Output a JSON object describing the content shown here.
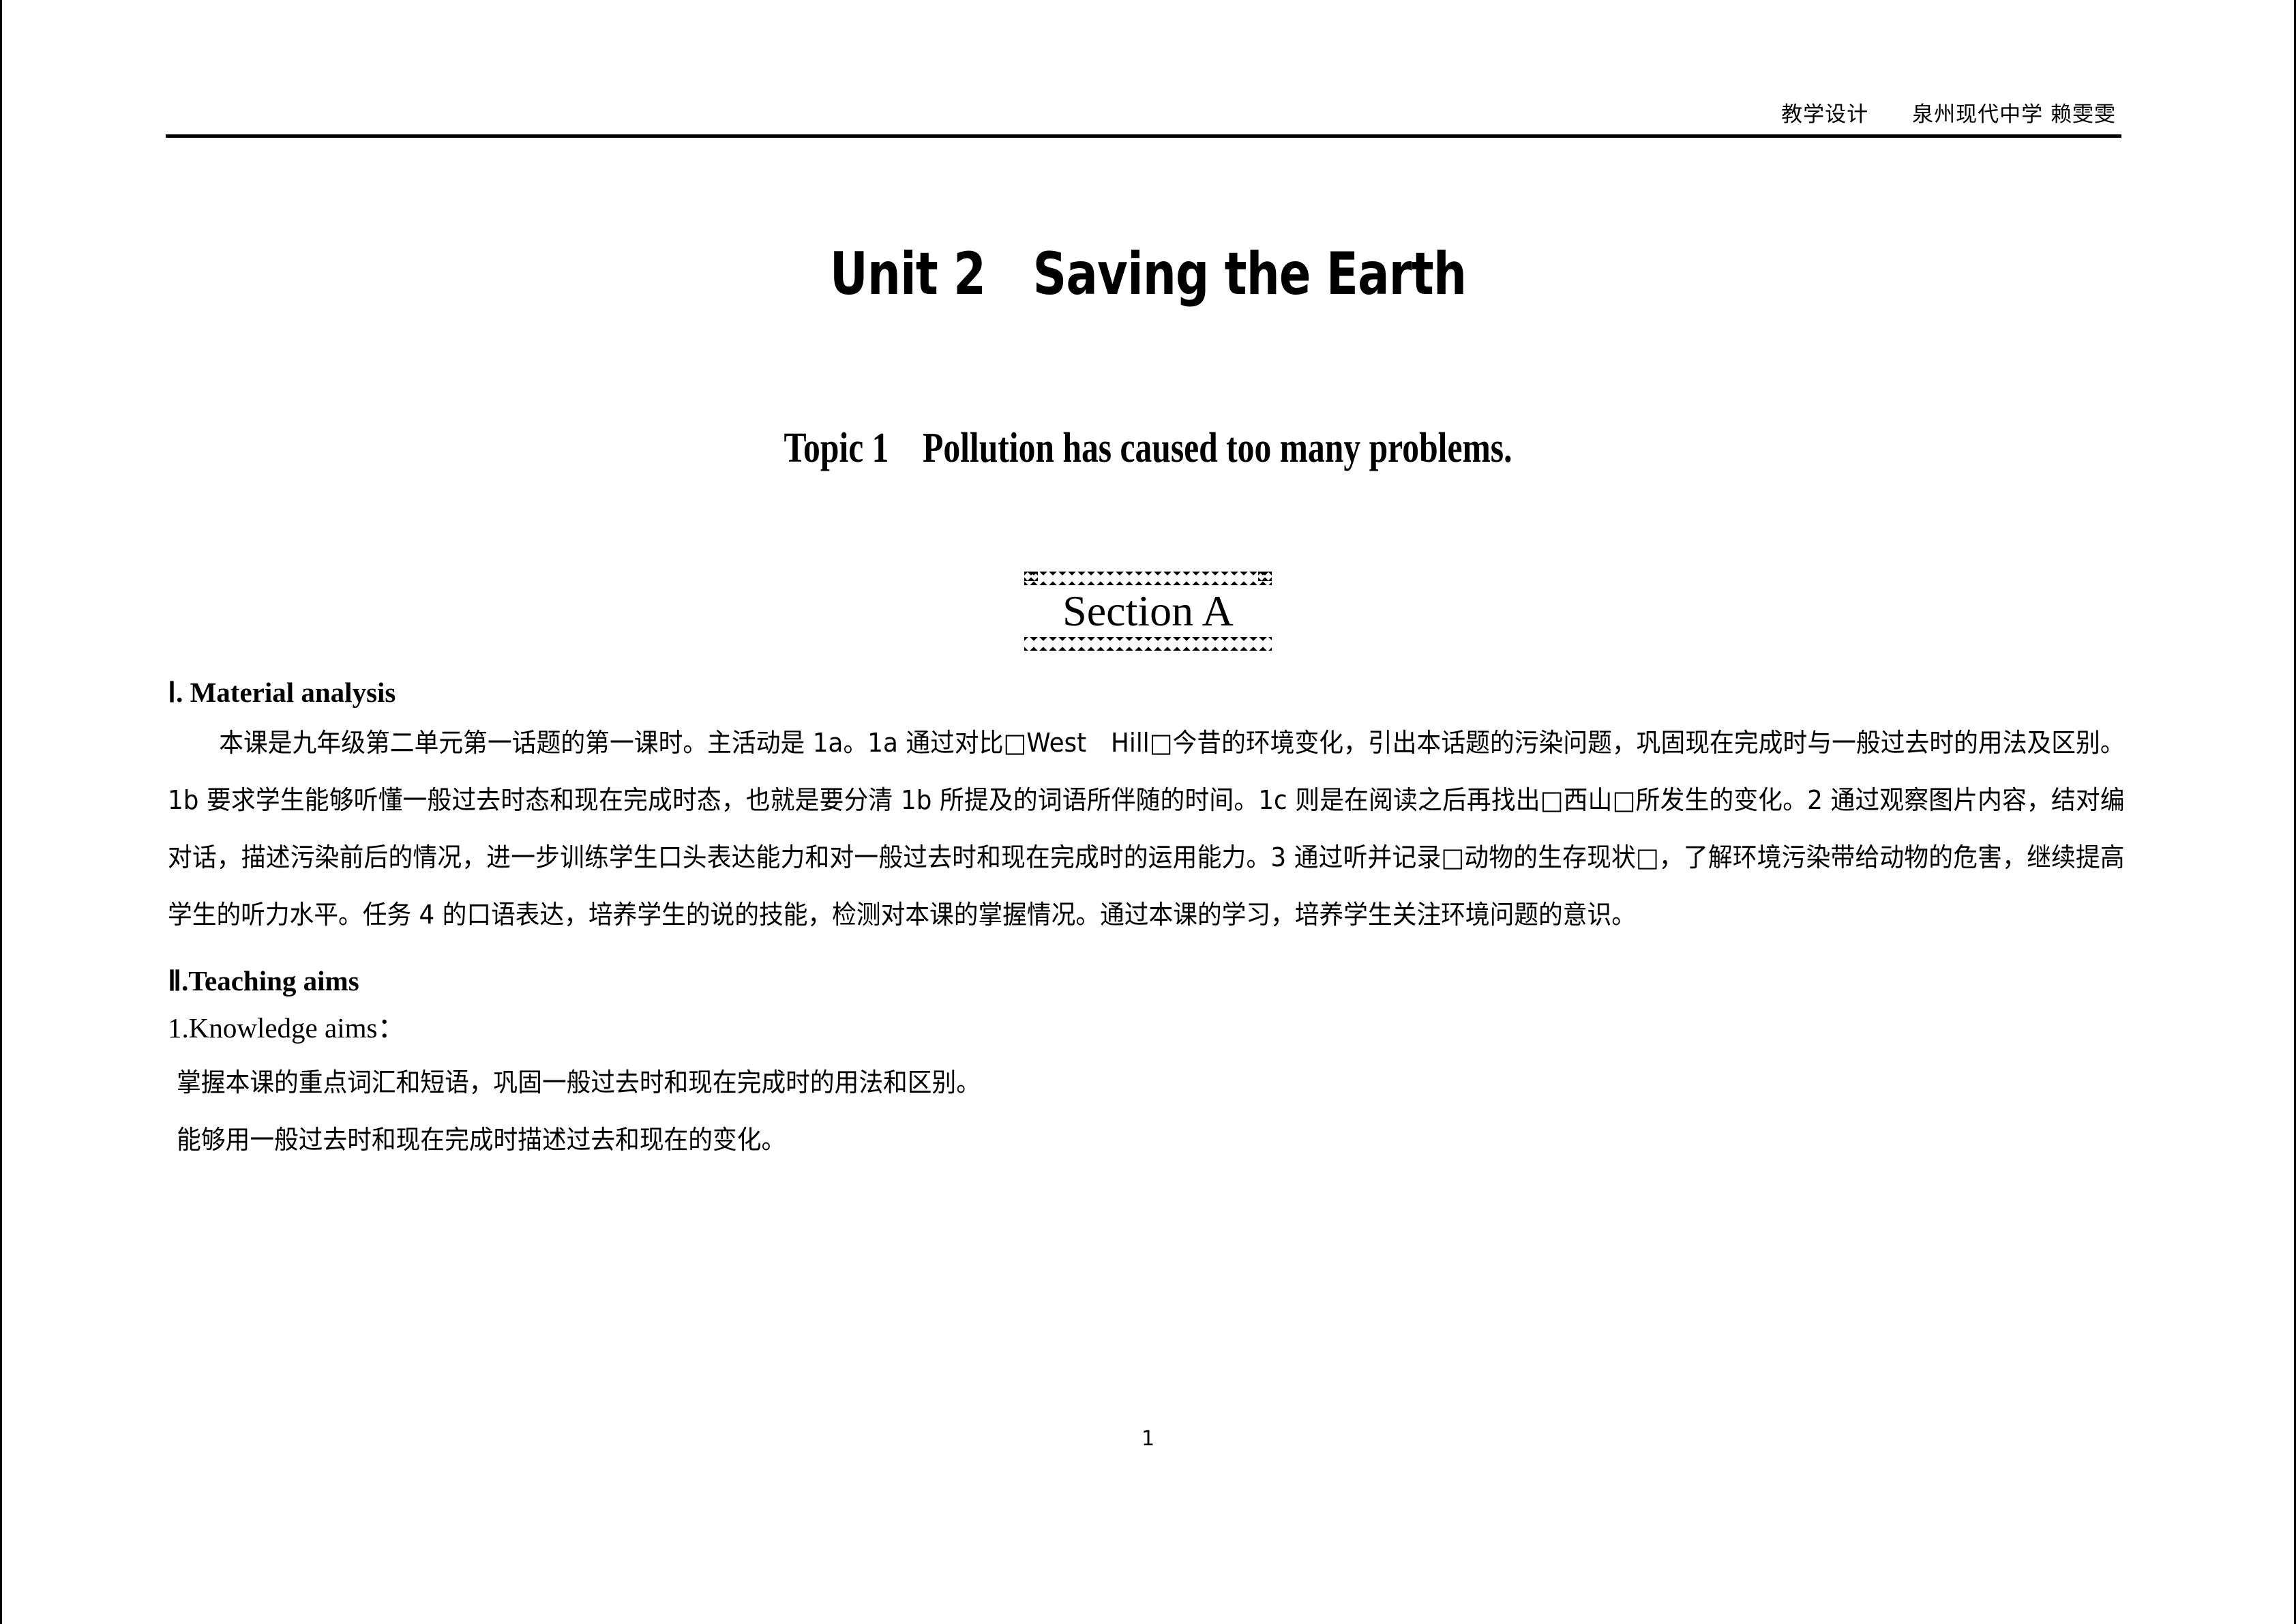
{
  "document": {
    "header": {
      "text": "教学设计　　泉州现代中学 赖雯雯"
    },
    "unit_title": "Unit 2   Saving the Earth",
    "topic_title": "Topic 1    Pollution has caused too many problems.",
    "section_badge": "Section A",
    "sections": [
      {
        "heading": "Ⅰ. Material analysis",
        "paragraph": "本课是九年级第二单元第一话题的第一课时。主活动是 1a。1a 通过对比□West　Hill□今昔的环境变化，引出本话题的污染问题，巩固现在完成时与一般过去时的用法及区别。1b 要求学生能够听懂一般过去时态和现在完成时态，也就是要分清 1b 所提及的词语所伴随的时间。1c 则是在阅读之后再找出□西山□所发生的变化。2 通过观察图片内容，结对编对话，描述污染前后的情况，进一步训练学生口头表达能力和对一般过去时和现在完成时的运用能力。3 通过听并记录□动物的生存现状□，了解环境污染带给动物的危害，继续提高学生的听力水平。任务 4 的口语表达，培养学生的说的技能，检测对本课的掌握情况。通过本课的学习，培养学生关注环境问题的意识。"
      },
      {
        "heading": "Ⅱ.Teaching aims",
        "aim_heading": "1.Knowledge aims：",
        "aims": [
          "掌握本课的重点词汇和短语，巩固一般过去时和现在完成时的用法和区别。",
          "能够用一般过去时和现在完成时描述过去和现在的变化。"
        ]
      }
    ],
    "page_number": "1",
    "colors": {
      "text": "#000000",
      "background": "#ffffff",
      "rule": "#000000"
    }
  }
}
